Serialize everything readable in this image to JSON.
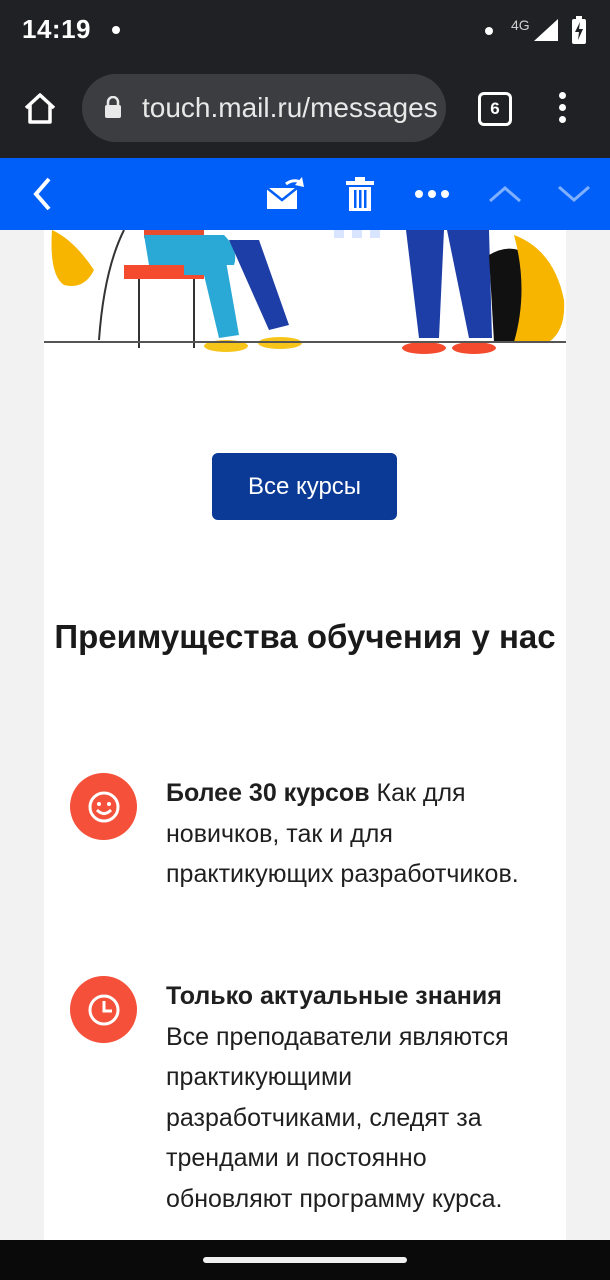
{
  "status_bar": {
    "time": "14:19",
    "network": "4G"
  },
  "browser": {
    "url": "touch.mail.ru/messages",
    "tab_count": "6"
  },
  "mail_toolbar": {
    "icons": [
      "back-icon",
      "move-to-folder-icon",
      "trash-icon",
      "more-icon",
      "previous-icon",
      "next-icon"
    ]
  },
  "content": {
    "button_label": "Все курсы",
    "section_title": "Преимущества обучения у нас",
    "benefits": [
      {
        "icon": "smile-icon",
        "title": "Более 30 курсов",
        "text": " Как для новичков, так и для практикующих разработчиков."
      },
      {
        "icon": "clock-icon",
        "title": "Только актуальные знания",
        "text": " Все преподаватели являются практикующими разработчиками, следят за трендами и постоянно обновляют программу курса."
      }
    ]
  },
  "colors": {
    "mail_blue": "#005ff9",
    "button_blue": "#0b3a96",
    "accent_red": "#f5503a",
    "dark_chrome": "#202124"
  }
}
